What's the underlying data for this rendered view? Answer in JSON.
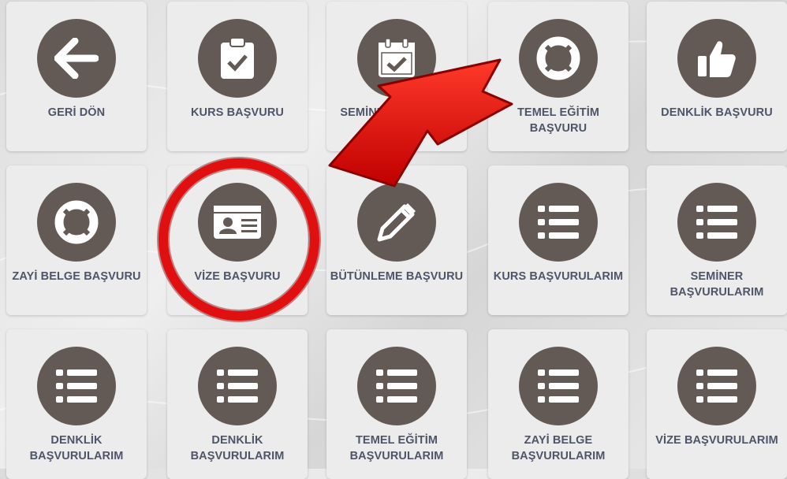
{
  "tiles": [
    {
      "label": "GERİ DÖN",
      "icon": "arrow-left-icon"
    },
    {
      "label": "KURS BAŞVURU",
      "icon": "clipboard-check-icon"
    },
    {
      "label": "SEMİNER BAŞVURU",
      "icon": "calendar-check-icon"
    },
    {
      "label": "TEMEL EĞİTİM BAŞVURU",
      "icon": "life-ring-icon"
    },
    {
      "label": "DENKLİK BAŞVURU",
      "icon": "thumbs-up-icon"
    },
    {
      "label": "ZAYİ BELGE BAŞVURU",
      "icon": "life-ring-icon"
    },
    {
      "label": "VİZE BAŞVURU",
      "icon": "id-card-icon"
    },
    {
      "label": "BÜTÜNLEME BAŞVURU",
      "icon": "pencil-icon"
    },
    {
      "label": "KURS BAŞVURULARIM",
      "icon": "list-icon"
    },
    {
      "label": "SEMİNER BAŞVURULARIM",
      "icon": "list-icon"
    },
    {
      "label": "DENKLİK BAŞVURULARIM",
      "icon": "list-icon"
    },
    {
      "label": "DENKLİK BAŞVURULARIM",
      "icon": "list-icon"
    },
    {
      "label": "TEMEL EĞİTİM BAŞVURULARIM",
      "icon": "list-icon"
    },
    {
      "label": "ZAYİ BELGE BAŞVURULARIM",
      "icon": "list-icon"
    },
    {
      "label": "VİZE BAŞVURULARIM",
      "icon": "list-icon"
    }
  ],
  "colors": {
    "icon_circle": "#645a55",
    "label_text": "#4f5569",
    "tile_bg": "#ececec",
    "annotation_red": "#e01010"
  }
}
